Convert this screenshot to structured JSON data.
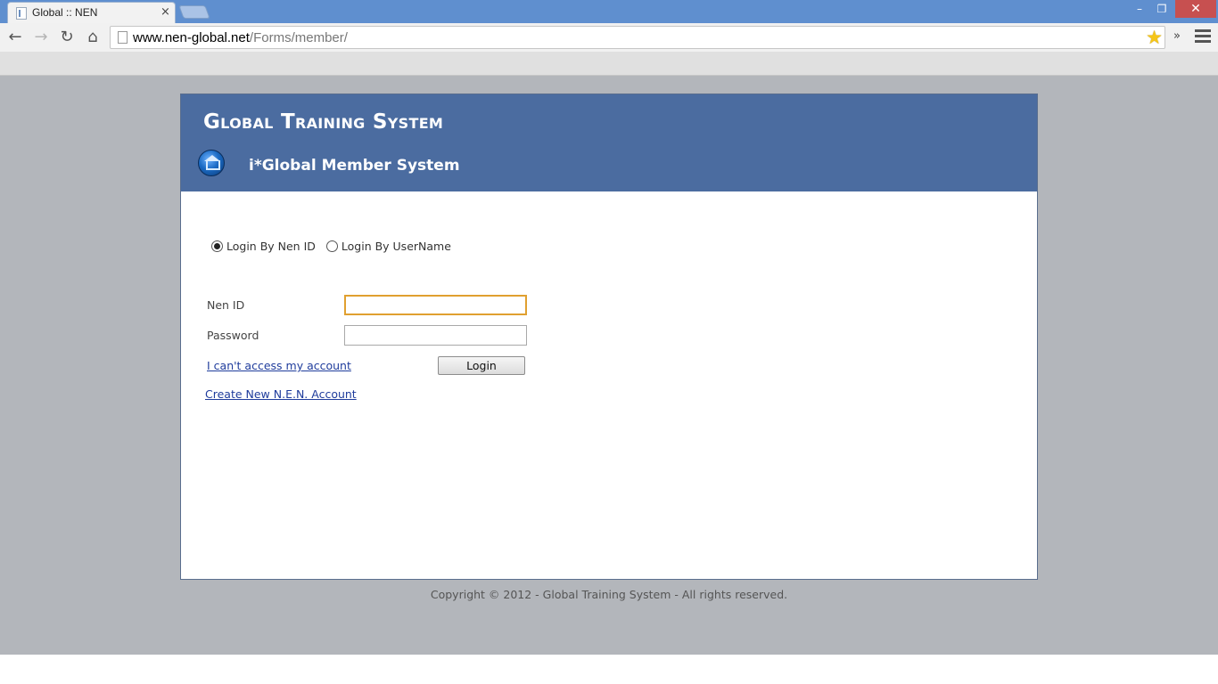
{
  "browser": {
    "tab_title": "Global :: NEN",
    "tab_close": "×",
    "url_host": "www.nen-global.net",
    "url_path": "/Forms/member/",
    "extensions_label": "»",
    "window_min": "–",
    "window_max": "❐",
    "window_close": "✕",
    "star_color": "#f5c518"
  },
  "header": {
    "site_title": "Global Training System",
    "subsystem_title": "i*Global Member System",
    "background_color": "#4b6ca0"
  },
  "login_mode": {
    "options": [
      {
        "label": "Login By Nen ID",
        "selected": true
      },
      {
        "label": "Login By UserName",
        "selected": false
      }
    ]
  },
  "form": {
    "nen_id_label": "Nen ID",
    "nen_id_value": "",
    "password_label": "Password",
    "password_value": "",
    "login_button": "Login",
    "cant_access_link": "I can't access my account",
    "create_account_link": "Create New N.E.N. Account"
  },
  "footer": {
    "copyright": "Copyright © 2012 - Global Training System - All rights reserved."
  }
}
